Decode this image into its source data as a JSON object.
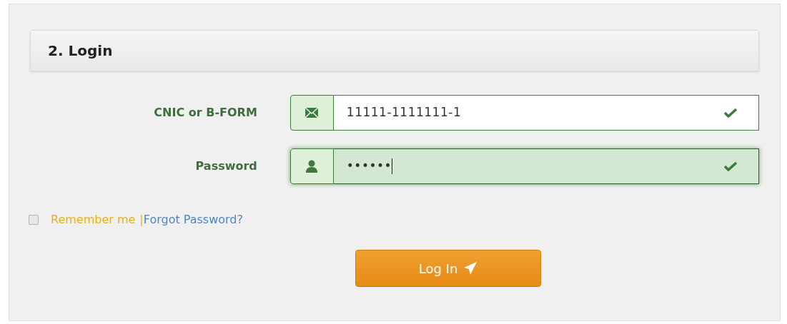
{
  "section": {
    "title": "2. Login"
  },
  "fields": [
    {
      "label": "CNIC or B-FORM",
      "kind": "email",
      "value": "11111-1111111-1",
      "valid": true,
      "focused": false
    },
    {
      "label": "Password",
      "kind": "password",
      "value": "••••••",
      "valid": true,
      "focused": true
    }
  ],
  "remember": {
    "label": "Remember me",
    "separator": "|",
    "checked": false
  },
  "forgot_link": "Forgot Password?",
  "submit": {
    "label": "Log In"
  }
}
